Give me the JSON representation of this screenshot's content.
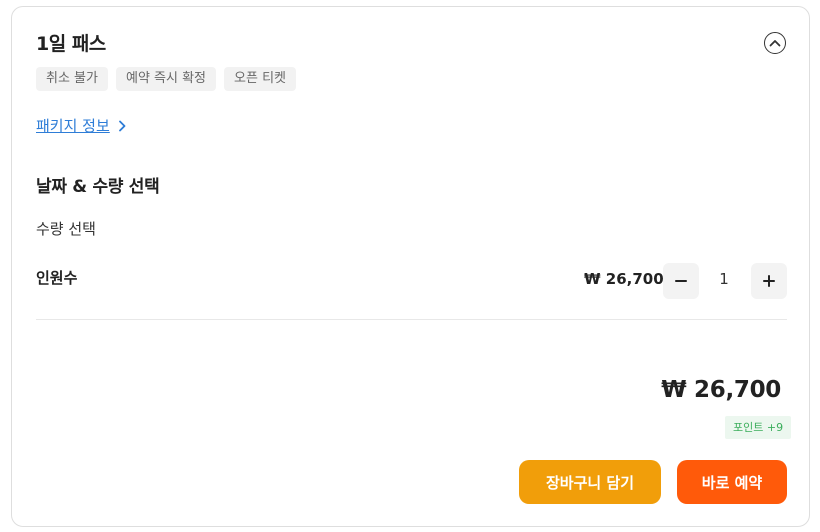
{
  "product": {
    "title": "1일 패스",
    "tags": [
      "취소 불가",
      "예약 즉시 확정",
      "오픈 티켓"
    ],
    "package_link": "패키지 정보"
  },
  "selection": {
    "section_title": "날짜 & 수량 선택",
    "quantity_label": "수량 선택",
    "row_label": "인원수",
    "unit_price": "₩ 26,700",
    "quantity": "1"
  },
  "summary": {
    "total": "₩ 26,700",
    "points": "포인트 +9"
  },
  "actions": {
    "cart_label": "장바구니 담기",
    "book_label": "바로 예약"
  },
  "colors": {
    "link": "#2e7dd7",
    "cart_button": "#f19e0a",
    "book_button": "#ff5a0a",
    "points_text": "#3bae5c"
  },
  "icons": [
    "chevron-up-circle-icon",
    "chevron-right-icon",
    "minus-icon",
    "plus-icon"
  ]
}
